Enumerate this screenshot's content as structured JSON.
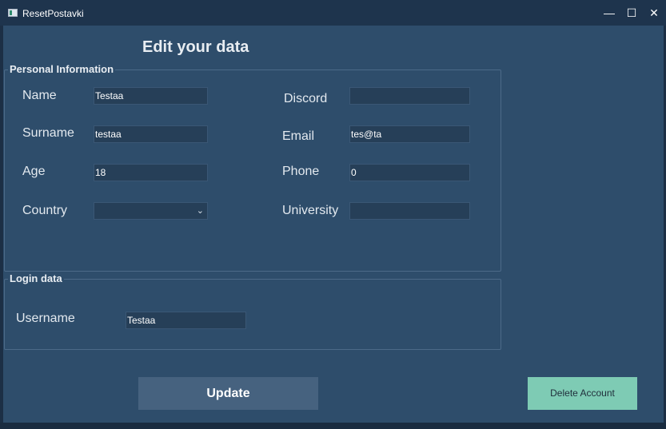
{
  "window": {
    "title": "ResetPostavki",
    "minimize": "—",
    "maximize": "☐",
    "close": "✕"
  },
  "heading": "Edit your data",
  "personal": {
    "title": "Personal Information",
    "name_label": "Name",
    "name_value": "Testaa",
    "surname_label": "Surname",
    "surname_value": "testaa",
    "age_label": "Age",
    "age_value": "18",
    "country_label": "Country",
    "country_value": "",
    "discord_label": "Discord",
    "discord_value": "",
    "email_label": "Email",
    "email_value": "tes@ta",
    "phone_label": "Phone",
    "phone_value": "0",
    "university_label": "University",
    "university_value": ""
  },
  "login": {
    "title": "Login data",
    "username_label": "Username",
    "username_value": "Testaa"
  },
  "buttons": {
    "update": "Update",
    "delete": "Delete Account"
  },
  "icons": {
    "dropdown": "chevron-down-icon",
    "app": "app-icon"
  }
}
